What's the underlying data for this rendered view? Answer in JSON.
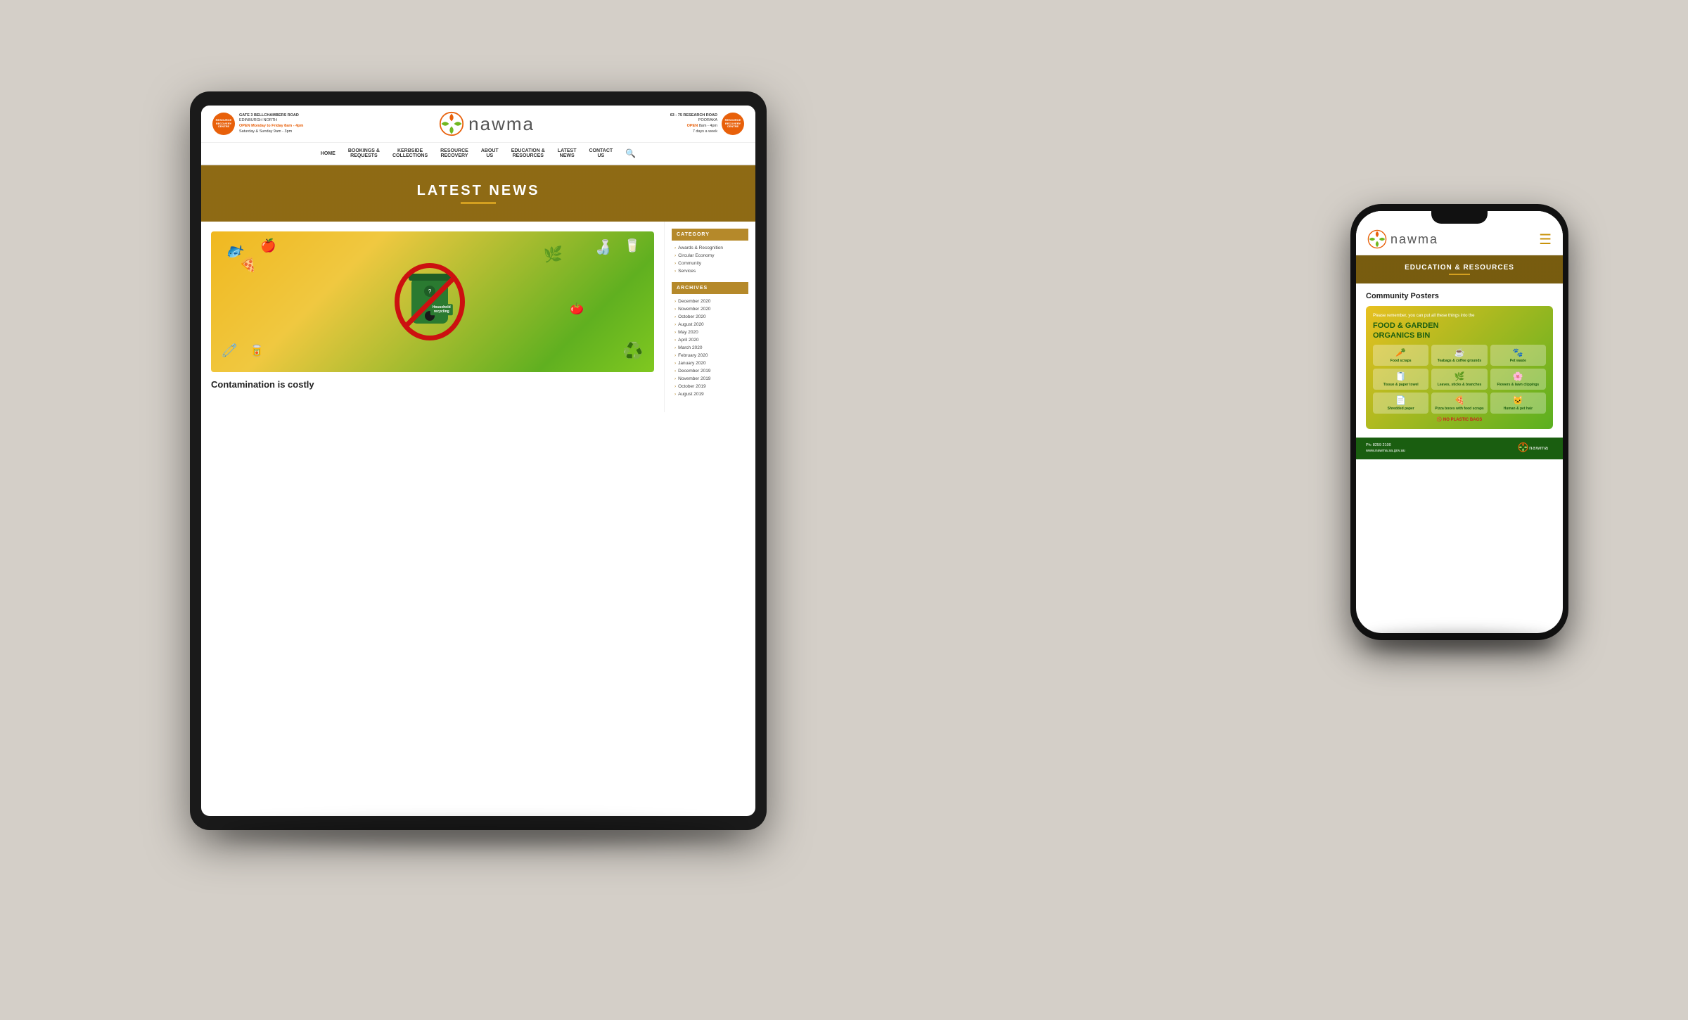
{
  "background_color": "#d4cfc8",
  "tablet": {
    "header": {
      "left_badge": "RESOURCE\nRECOVERY\nCENTRE",
      "left_address_line1": "GATE 3 BELLCHAMBERS ROAD",
      "left_address_line2": "EDINBURGH NORTH",
      "left_open": "OPEN Monday to Friday 8am - 4pm",
      "left_open2": "Saturday & Sunday 9am - 3pm",
      "logo_text": "nawma",
      "right_address_line1": "63 - 75 RESEARCH ROAD",
      "right_address_line2": "POORAKA",
      "right_open": "OPEN 8am - 4pm",
      "right_open2": "7 days a week",
      "right_badge": "RESOURCE\nRECOVERY\nCENTRE"
    },
    "nav": {
      "items": [
        {
          "label": "HOME"
        },
        {
          "label": "BOOKINGS &\nREQUESTS"
        },
        {
          "label": "KERBSIDE\nCOLLECTIONS"
        },
        {
          "label": "RESOURCE\nRECOVERY"
        },
        {
          "label": "ABOUT\nUS"
        },
        {
          "label": "EDUCATION &\nRESOURCES"
        },
        {
          "label": "LATEST\nNEWS"
        },
        {
          "label": "CONTACT\nUS"
        }
      ]
    },
    "banner": {
      "title": "LATEST NEWS"
    },
    "news": {
      "headline": "Contamination is costly"
    },
    "sidebar": {
      "category_title": "CATEGORY",
      "categories": [
        "Awards & Recognition",
        "Circular Economy",
        "Community",
        "Services"
      ],
      "archives_title": "ARCHIVES",
      "archives": [
        "December 2020",
        "November 2020",
        "October 2020",
        "August 2020",
        "May 2020",
        "April 2020",
        "March 2020",
        "February 2020",
        "January 2020",
        "December 2019",
        "November 2019",
        "October 2019",
        "August 2019"
      ]
    }
  },
  "phone": {
    "logo_text": "nawma",
    "banner_title": "EDUCATION & RESOURCES",
    "section_title": "Community Posters",
    "poster": {
      "reminder": "Please remember, you can put all these things into the",
      "bin_name": "FOOD & GARDEN\nORGANICS BIN",
      "items": [
        {
          "icon": "🥕",
          "label": "Food scraps"
        },
        {
          "icon": "🍵",
          "label": "Teabags & coffee grounds"
        },
        {
          "icon": "🐾",
          "label": "Pet waste"
        },
        {
          "icon": "🧻",
          "label": "Tissue & paper towel"
        },
        {
          "icon": "🌿",
          "label": "Leaves, sticks & branches"
        },
        {
          "icon": "🌸",
          "label": "Flowers & lawn clippings"
        },
        {
          "icon": "📄",
          "label": "Shredded paper"
        },
        {
          "icon": "🍕",
          "label": "Pizza boxes with food scraps"
        },
        {
          "icon": "🐱",
          "label": "Human & pet hair"
        }
      ],
      "no_plastic": "NO PLASTIC BAGS"
    },
    "footer": {
      "phone": "Ph: 8259 2100",
      "website": "www.nawma.sa.gov.au",
      "logo": "nawma"
    }
  }
}
